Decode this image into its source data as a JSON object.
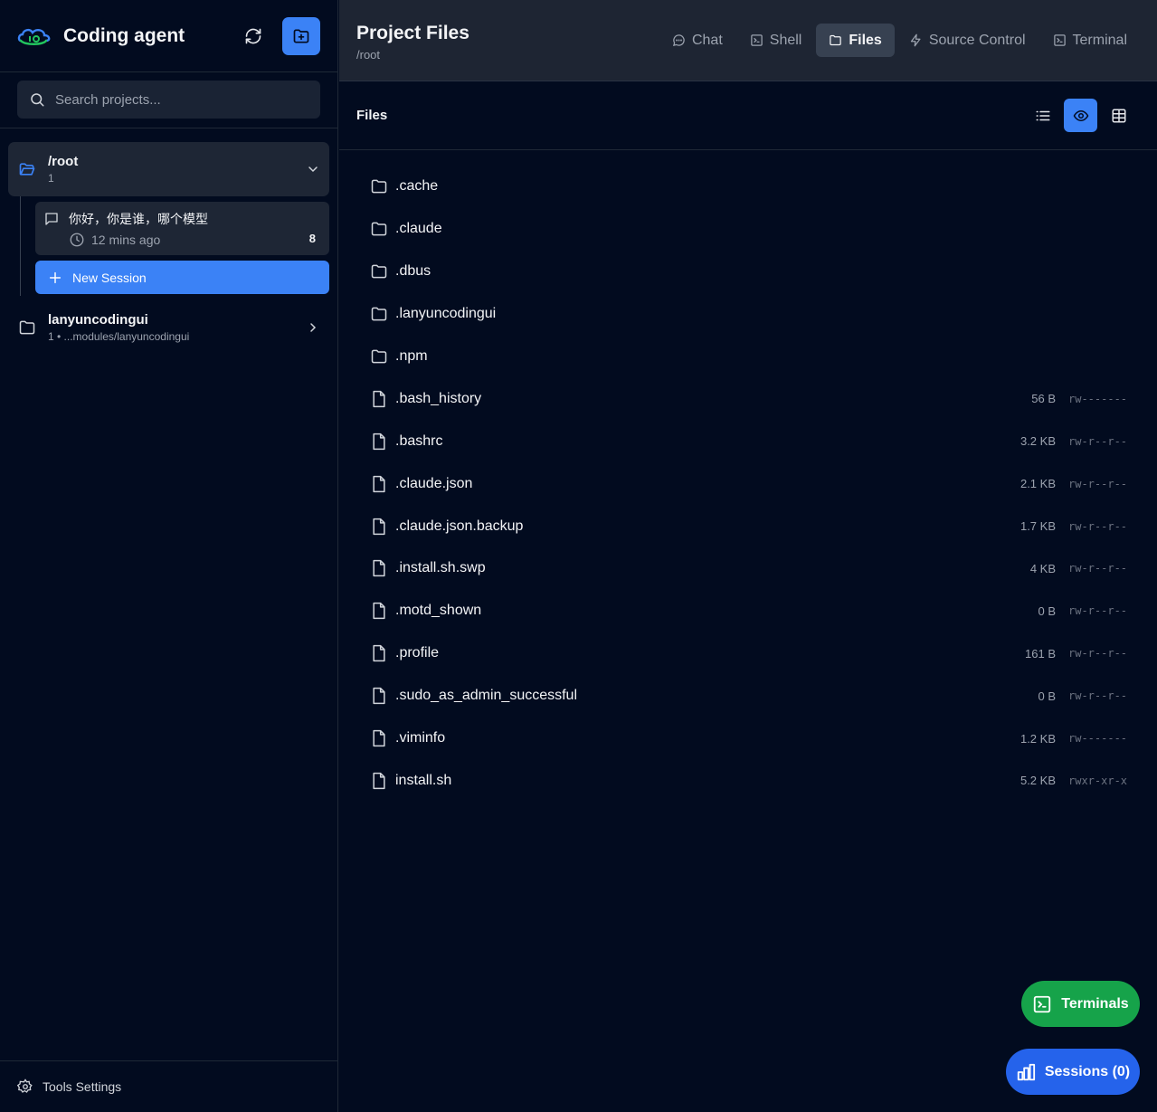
{
  "sidebar": {
    "app_title": "Coding agent",
    "search": {
      "placeholder": "Search projects..."
    },
    "projects": [
      {
        "name": "/root",
        "meta": "1",
        "expanded": true,
        "sessions": [
          {
            "title": "你好，你是谁，哪个模型",
            "time": "12 mins ago",
            "count": "8"
          }
        ],
        "new_session_label": "New Session"
      },
      {
        "name": "lanyuncodingui",
        "meta": "1 • ...modules/lanyuncodingui",
        "expanded": false
      }
    ],
    "footer_label": "Tools Settings"
  },
  "header": {
    "title": "Project Files",
    "path": "/root",
    "tabs": [
      {
        "label": "Chat",
        "icon": "chat-bubble-icon",
        "active": false
      },
      {
        "label": "Shell",
        "icon": "terminal-square-icon",
        "active": false
      },
      {
        "label": "Files",
        "icon": "folder-icon",
        "active": true
      },
      {
        "label": "Source Control",
        "icon": "lightning-icon",
        "active": false
      },
      {
        "label": "Terminal",
        "icon": "terminal-square-icon",
        "active": false
      }
    ]
  },
  "files_panel": {
    "title": "Files",
    "view_modes": [
      "list",
      "preview",
      "grid"
    ],
    "active_view": "preview",
    "entries": [
      {
        "name": ".cache",
        "type": "folder",
        "size": "",
        "perm": ""
      },
      {
        "name": ".claude",
        "type": "folder",
        "size": "",
        "perm": ""
      },
      {
        "name": ".dbus",
        "type": "folder",
        "size": "",
        "perm": ""
      },
      {
        "name": ".lanyuncodingui",
        "type": "folder",
        "size": "",
        "perm": ""
      },
      {
        "name": ".npm",
        "type": "folder",
        "size": "",
        "perm": ""
      },
      {
        "name": ".bash_history",
        "type": "file",
        "size": "56 B",
        "perm": "rw-------"
      },
      {
        "name": ".bashrc",
        "type": "file",
        "size": "3.2 KB",
        "perm": "rw-r--r--"
      },
      {
        "name": ".claude.json",
        "type": "file",
        "size": "2.1 KB",
        "perm": "rw-r--r--"
      },
      {
        "name": ".claude.json.backup",
        "type": "file",
        "size": "1.7 KB",
        "perm": "rw-r--r--"
      },
      {
        "name": ".install.sh.swp",
        "type": "file",
        "size": "4 KB",
        "perm": "rw-r--r--"
      },
      {
        "name": ".motd_shown",
        "type": "file",
        "size": "0 B",
        "perm": "rw-r--r--"
      },
      {
        "name": ".profile",
        "type": "file",
        "size": "161 B",
        "perm": "rw-r--r--"
      },
      {
        "name": ".sudo_as_admin_successful",
        "type": "file",
        "size": "0 B",
        "perm": "rw-r--r--"
      },
      {
        "name": ".viminfo",
        "type": "file",
        "size": "1.2 KB",
        "perm": "rw-------"
      },
      {
        "name": "install.sh",
        "type": "file",
        "size": "5.2 KB",
        "perm": "rwxr-xr-x"
      }
    ]
  },
  "floating": {
    "terminals_label": "Terminals",
    "sessions_label": "Sessions (0)"
  },
  "colors": {
    "accent": "#3b82f6",
    "success": "#16a34a",
    "background": "#020b1f",
    "header_bg": "#1e2533"
  }
}
